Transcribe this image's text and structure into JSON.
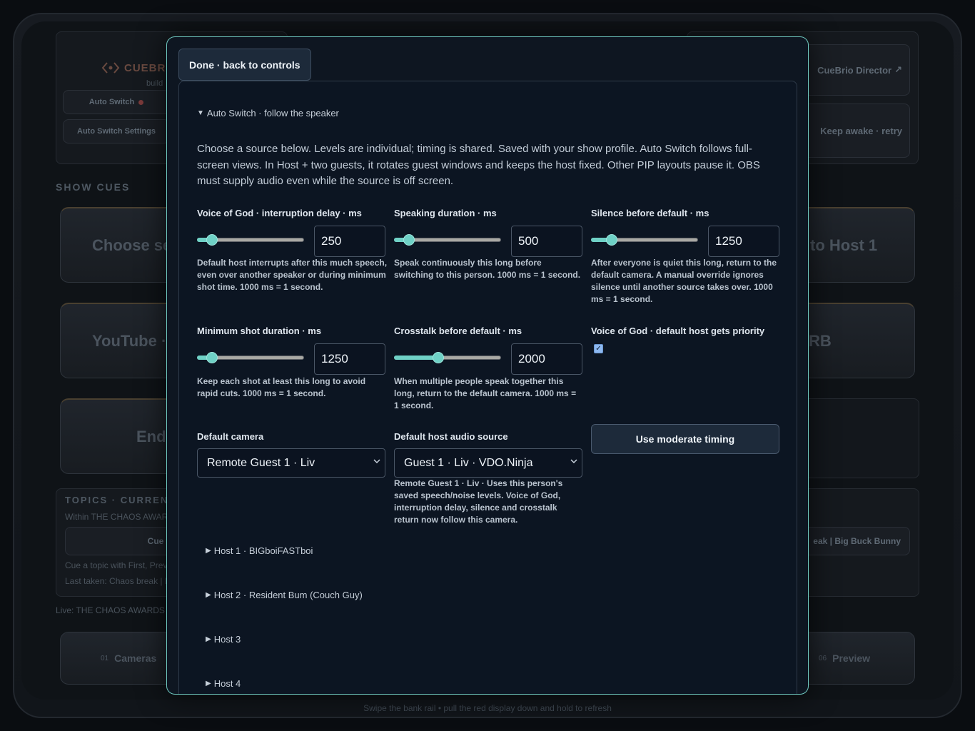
{
  "background": {
    "logo_text": "CUEBRI",
    "logo_sub": "build",
    "auto_switch_label": "Auto Switch",
    "auto_switch_settings_label": "Auto Switch Settings",
    "director_link": "CueBrio Director",
    "keep_awake": "Keep awake · retry",
    "show_cues_title": "SHOW CUES",
    "cue_choose": "Choose se",
    "cue_to_host": "to Host 1",
    "cue_youtube": "YouTube ·",
    "cue_rb": "RB",
    "cue_end": "End",
    "topics_title": "TOPICS · CURRENT S",
    "topics_within": "Within THE CHAOS AWAR",
    "cue_first": "Cue fi",
    "topics_hint": "Cue a topic with First, Prev",
    "last_taken": "Last taken: Chaos break | I",
    "break_label": "eak | Big Buck Bunny",
    "live_label": "Live: THE CHAOS AWARDS",
    "bank_cameras_num": "01",
    "bank_cameras": "Cameras",
    "bank_preview_num": "06",
    "bank_preview": "Preview",
    "footer_hint": "Swipe the bank rail • pull the red display down and hold to refresh"
  },
  "modal": {
    "done_label": "Done · back to controls",
    "section_title": "Auto Switch · follow the speaker",
    "intro": "Choose a source below. Levels are individual; timing is shared. Saved with your show profile. Auto Switch follows full-screen views. In Host + two guests, it rotates guest windows and keeps the host fixed. Other PIP layouts pause it. OBS must supply audio even while the source is off screen.",
    "fields": {
      "vog_delay": {
        "label": "Voice of God · interruption delay · ms",
        "value": "250",
        "slider_fraction": 0.1,
        "help": "Default host interrupts after this much speech, even over another speaker or during minimum shot time. 1000 ms = 1 second."
      },
      "speaking": {
        "label": "Speaking duration · ms",
        "value": "500",
        "slider_fraction": 0.1,
        "help": "Speak continuously this long before switching to this person. 1000 ms = 1 second."
      },
      "silence": {
        "label": "Silence before default · ms",
        "value": "1250",
        "slider_fraction": 0.16,
        "help": "After everyone is quiet this long, return to the default camera. A manual override ignores silence until another source takes over. 1000 ms = 1 second."
      },
      "min_shot": {
        "label": "Minimum shot duration · ms",
        "value": "1250",
        "slider_fraction": 0.1,
        "help": "Keep each shot at least this long to avoid rapid cuts. 1000 ms = 1 second."
      },
      "crosstalk": {
        "label": "Crosstalk before default · ms",
        "value": "2000",
        "slider_fraction": 0.4,
        "help": "When multiple people speak together this long, return to the default camera. 1000 ms = 1 second."
      },
      "vog_priority": {
        "label": "Voice of God · default host gets priority",
        "checked": true
      }
    },
    "moderate_label": "Use moderate timing",
    "default_camera_label": "Default camera",
    "default_camera_value": "Remote Guest 1 · Liv",
    "default_audio_label": "Default host audio source",
    "default_audio_value": "Guest 1 · Liv · VDO.Ninja",
    "default_audio_help": "Remote Guest 1 · Liv · Uses this person's saved speech/noise levels. Voice of God, interruption delay, silence and crosstalk return now follow this camera.",
    "hosts": [
      "Host 1 · BIGboiFASTboi",
      "Host 2 · Resident Bum (Couch Guy)",
      "Host 3",
      "Host 4"
    ]
  }
}
